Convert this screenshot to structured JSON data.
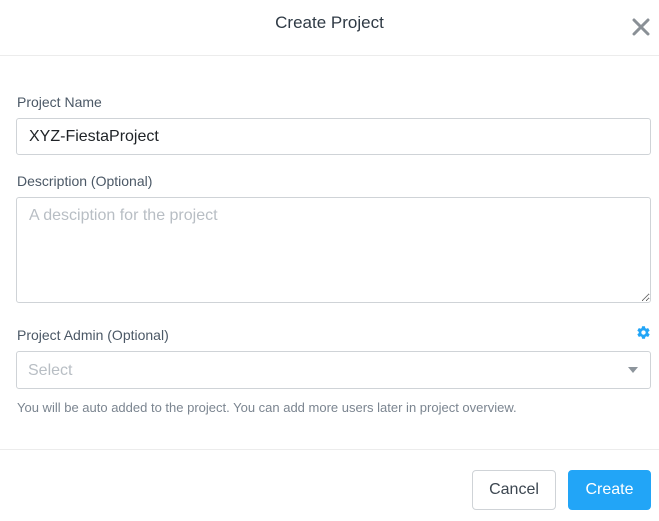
{
  "dialog": {
    "title": "Create Project",
    "close_icon": "close-icon"
  },
  "form": {
    "name": {
      "label": "Project Name",
      "value": "XYZ-FiestaProject"
    },
    "description": {
      "label": "Description (Optional)",
      "placeholder": "A desciption for the project",
      "value": ""
    },
    "admin": {
      "label": "Project Admin (Optional)",
      "placeholder": "Select",
      "settings_icon": "gear-icon",
      "hint": "You will be auto added to the project. You can add more users later in project overview."
    }
  },
  "footer": {
    "cancel_label": "Cancel",
    "create_label": "Create"
  },
  "colors": {
    "accent": "#22a5f7",
    "text": "#2f3a45",
    "border": "#cfd3d7"
  }
}
